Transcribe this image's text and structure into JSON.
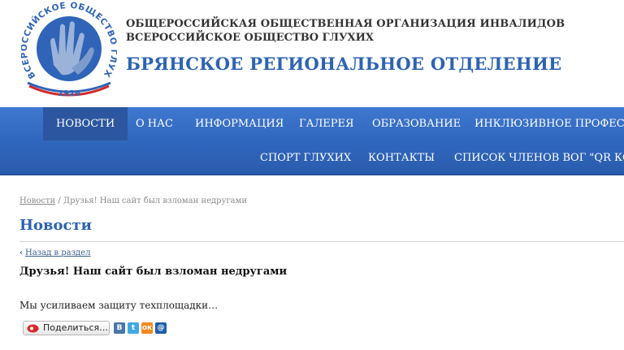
{
  "header": {
    "logo": {
      "ring_text": "ВСЕРОССИЙСКОЕ ОБЩЕСТВО ГЛУХИХ",
      "year": "1926"
    },
    "org_line1": "ОБЩЕРОССИЙСКАЯ ОБЩЕСТВЕННАЯ ОРГАНИЗАЦИЯ ИНВАЛИДОВ",
    "org_line2": "ВСЕРОССИЙСКОЕ ОБЩЕСТВО ГЛУХИХ",
    "region": "БРЯНСКОЕ РЕГИОНАЛЬНОЕ ОТДЕЛЕНИЕ"
  },
  "nav": {
    "row1": [
      {
        "label": "НОВОСТИ",
        "active": true
      },
      {
        "label": "О НАС"
      },
      {
        "label": "ИНФОРМАЦИЯ"
      },
      {
        "label": "ГАЛЕРЕЯ"
      },
      {
        "label": "ОБРАЗОВАНИЕ"
      },
      {
        "label": "ИНКЛЮЗИВНОЕ ПРОФЕССИО"
      }
    ],
    "row2": [
      {
        "label": "СПОРТ ГЛУХИХ"
      },
      {
        "label": "КОНТАКТЫ"
      },
      {
        "label": "СПИСОК ЧЛЕНОВ ВОГ \"QR КОД\""
      }
    ]
  },
  "breadcrumb": {
    "home": "Новости",
    "separator": "/",
    "current": "Друзья! Наш сайт был взломан недругами"
  },
  "page_title": "Новости",
  "back_link": "Назад в раздел",
  "article": {
    "title": "Друзья! Наш сайт был взломан недругами",
    "body": "Мы усиливаем защиту техплощадки…"
  },
  "share": {
    "button_label": "Поделиться…",
    "icons": [
      {
        "name": "vk-icon",
        "glyph": "В",
        "color": "#4a76a8"
      },
      {
        "name": "twitter-icon",
        "glyph": "t",
        "color": "#3fa9e6"
      },
      {
        "name": "odnoklassniki-icon",
        "glyph": "ок",
        "color": "#f08a1c"
      },
      {
        "name": "mailru-icon",
        "glyph": "@",
        "color": "#1f5ea8"
      }
    ]
  },
  "colors": {
    "brand_blue": "#2d63b3",
    "nav_blue": "#3f78cf",
    "nav_active": "#2c569f"
  }
}
